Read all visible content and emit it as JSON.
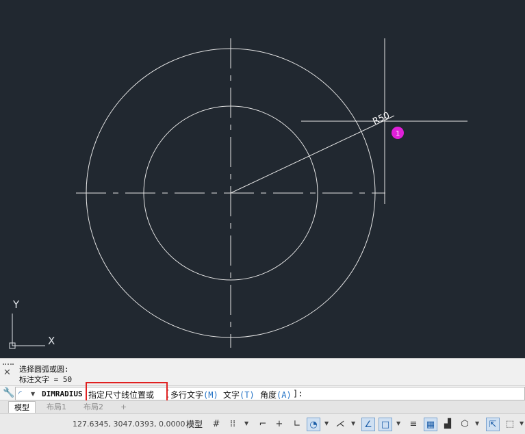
{
  "drawing": {
    "dimension_text": "R50",
    "marker_number": "1",
    "ucs_x_label": "X",
    "ucs_y_label": "Y",
    "line_color": "#e6e6e6",
    "background_color": "#212830",
    "marker_color": "#e020d8"
  },
  "command_history": {
    "line1": "选择圆弧或圆:",
    "line2": "标注文字 = 50"
  },
  "command_line": {
    "command_name": "DIMRADIUS",
    "prompt": "指定尺寸线位置或",
    "open_bracket": "[",
    "options": [
      {
        "label": "多行文字",
        "key": "(M)"
      },
      {
        "label": "文字",
        "key": "(T)"
      },
      {
        "label": "角度",
        "key": "(A)"
      }
    ],
    "close": "]:"
  },
  "layout_tabs": {
    "model": "模型",
    "layout1": "布局1",
    "layout2": "布局2",
    "add": "+"
  },
  "status_bar": {
    "coordinates": "127.6345, 3047.0393, 0.0000",
    "model_label": "模型"
  }
}
